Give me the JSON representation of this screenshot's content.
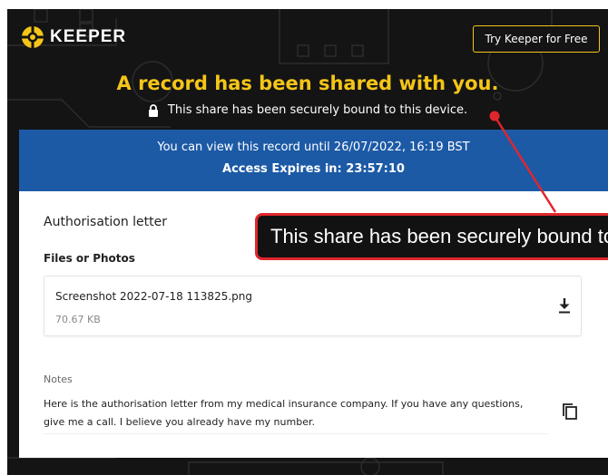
{
  "brand": {
    "name": "KEEPER",
    "logo_icon": "keeper-logo-icon"
  },
  "header": {
    "cta_label": "Try Keeper for Free"
  },
  "hero": {
    "title": "A record has been shared with you.",
    "bound_text": "This share has been securely bound to this device."
  },
  "access": {
    "view_until": "You can view this record until  26/07/2022, 16:19 BST",
    "expires_label": "Access Expires in:",
    "expires_value": "23:57:10"
  },
  "record": {
    "title": "Authorisation letter",
    "files_label": "Files or Photos",
    "file": {
      "name": "Screenshot 2022-07-18 113825.png",
      "size": "70.67 KB"
    },
    "notes_label": "Notes",
    "notes": "Here is the authorisation letter from my medical insurance company. If you have any questions, give me a call. I believe you already have my number."
  },
  "annotation": {
    "callout_text": "This share has been securely bound to this device."
  },
  "colors": {
    "background": "#141414",
    "accent_yellow": "#f5c518",
    "banner_blue": "#1c5aa6",
    "annotation_red": "#e0262d"
  }
}
